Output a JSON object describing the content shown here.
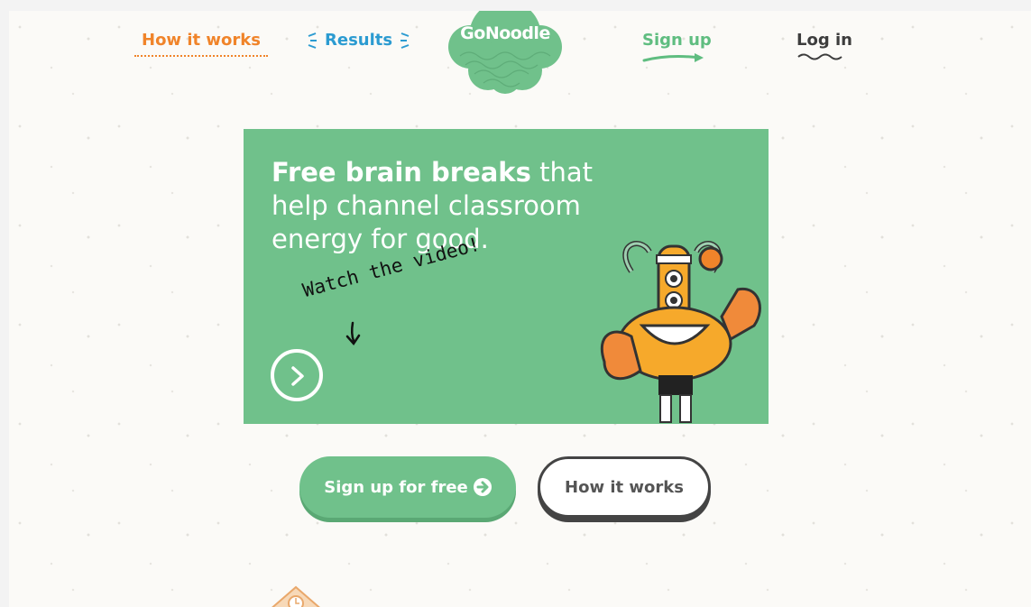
{
  "nav": {
    "how_it_works": "How it works",
    "results": "Results",
    "logo": "GoNoodle",
    "sign_up": "Sign up",
    "log_in": "Log in"
  },
  "hero": {
    "headline_bold": "Free brain breaks",
    "headline_rest": "that help channel classroom energy for good.",
    "watch_label": "Watch the video!"
  },
  "buttons": {
    "sign_up_free": "Sign up for free",
    "how_it_works": "How it works"
  },
  "colors": {
    "brand_green": "#70c18b",
    "orange": "#f0842a",
    "blue": "#2b9bd1",
    "dark": "#3d3d3d"
  },
  "icons": [
    "play-circle-icon",
    "arrow-right-circle-icon",
    "monster-illustration",
    "house-clock-icon"
  ]
}
